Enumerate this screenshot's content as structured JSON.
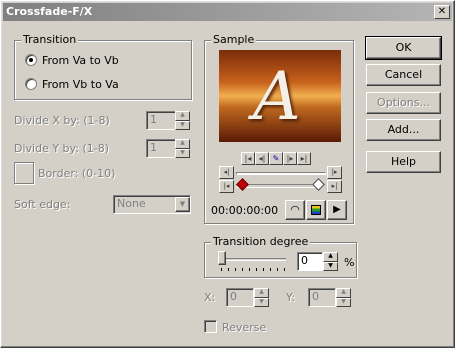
{
  "window": {
    "title": "Crossfade-F/X",
    "close_glyph": "✕"
  },
  "transition": {
    "legend": "Transition",
    "options": [
      {
        "label": "From Va to Vb",
        "selected": true
      },
      {
        "label": "From Vb to Va",
        "selected": false
      }
    ]
  },
  "divide_x": {
    "label": "Divide X by: (1-8)",
    "value": "1"
  },
  "divide_y": {
    "label": "Divide Y by: (1-8)",
    "value": "1"
  },
  "border": {
    "label": "Border: (0-10)"
  },
  "soft_edge": {
    "label": "Soft edge:",
    "value": "None"
  },
  "sample": {
    "legend": "Sample",
    "preview_letter": "A",
    "timecode": "00:00:00:00"
  },
  "transition_degree": {
    "legend": "Transition degree",
    "value": "0",
    "unit": "%",
    "slider_level": 0
  },
  "x": {
    "label": "X:",
    "value": "0"
  },
  "y": {
    "label": "Y:",
    "value": "0"
  },
  "reverse": {
    "label": "Reverse",
    "checked": false
  },
  "buttons": {
    "ok": "OK",
    "cancel": "Cancel",
    "options": "Options...",
    "add": "Add...",
    "help": "Help"
  },
  "icons": [
    "close-icon",
    "play-icon",
    "timeline-icon",
    "gauge-icon",
    "spin-up-icon",
    "spin-down-icon",
    "dropdown-arrow-icon"
  ]
}
